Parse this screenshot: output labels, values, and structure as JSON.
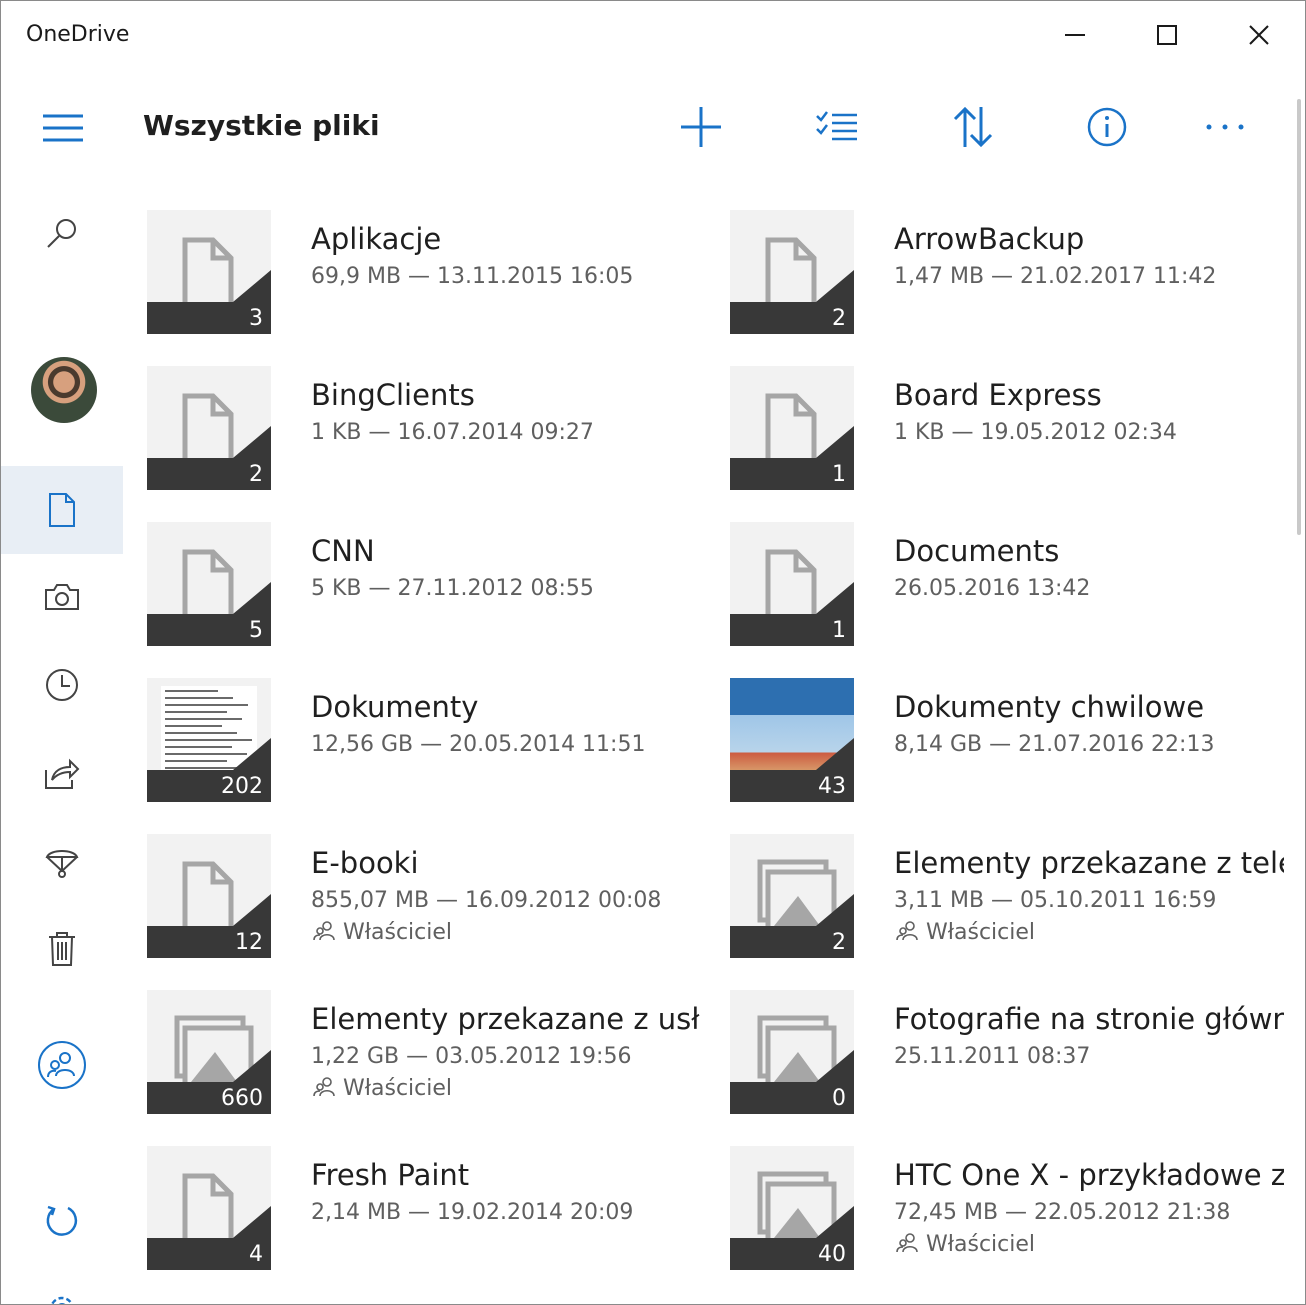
{
  "window": {
    "title": "OneDrive",
    "controls": {
      "minimize": "minimize",
      "maximize": "maximize",
      "close": "close"
    }
  },
  "header": {
    "title": "Wszystkie pliki",
    "tools": [
      "add-icon",
      "select-icon",
      "sort-icon",
      "info-icon",
      "more-icon"
    ]
  },
  "sidebar": {
    "items": [
      "search-icon",
      "avatar",
      "files-icon",
      "photos-icon",
      "recent-icon",
      "shared-icon",
      "recycle-icon",
      "trash-icon",
      "people-icon",
      "sync-icon",
      "settings-icon"
    ],
    "active": "files-icon"
  },
  "colors": {
    "accent": "#1a73c8",
    "badge_bg": "#383838",
    "thumb_bg": "#f2f2f2",
    "active_nav_bg": "#e8eef5"
  },
  "items": [
    {
      "name": "Aplikacje",
      "meta": "69,9 MB — 13.11.2015 16:05",
      "count": "3",
      "thumb": "folder-icon"
    },
    {
      "name": "ArrowBackup",
      "meta": "1,47 MB — 21.02.2017 11:42",
      "count": "2",
      "thumb": "folder-icon"
    },
    {
      "name": "BingClients",
      "meta": "1 KB — 16.07.2014 09:27",
      "count": "2",
      "thumb": "folder-icon"
    },
    {
      "name": "Board Express",
      "meta": "1 KB — 19.05.2012 02:34",
      "count": "1",
      "thumb": "folder-icon"
    },
    {
      "name": "CNN",
      "meta": "5 KB — 27.11.2012 08:55",
      "count": "5",
      "thumb": "folder-icon"
    },
    {
      "name": "Documents",
      "meta": "26.05.2016 13:42",
      "count": "1",
      "thumb": "folder-icon"
    },
    {
      "name": "Dokumenty",
      "meta": "12,56 GB — 20.05.2014 11:51",
      "count": "202",
      "thumb": "document-preview"
    },
    {
      "name": "Dokumenty chwilowe",
      "meta": "8,14 GB — 21.07.2016 22:13",
      "count": "43",
      "thumb": "photo-preview"
    },
    {
      "name": "E-booki",
      "meta": "855,07 MB — 16.09.2012 00:08",
      "owner": "Właściciel",
      "count": "12",
      "thumb": "folder-icon"
    },
    {
      "name": "Elementy przekazane z telefo",
      "meta": "3,11 MB — 05.10.2011 16:59",
      "owner": "Właściciel",
      "count": "2",
      "thumb": "gallery-icon"
    },
    {
      "name": "Elementy przekazane z usługi",
      "meta": "1,22 GB — 03.05.2012 19:56",
      "owner": "Właściciel",
      "count": "660",
      "thumb": "gallery-icon"
    },
    {
      "name": "Fotografie na stronie głównej",
      "meta": "25.11.2011 08:37",
      "count": "0",
      "thumb": "gallery-icon"
    },
    {
      "name": "Fresh Paint",
      "meta": "2,14 MB — 19.02.2014 20:09",
      "count": "4",
      "thumb": "folder-icon"
    },
    {
      "name": "HTC One X - przykładowe zdj",
      "meta": "72,45 MB — 22.05.2012 21:38",
      "owner": "Właściciel",
      "count": "40",
      "thumb": "gallery-icon"
    }
  ]
}
